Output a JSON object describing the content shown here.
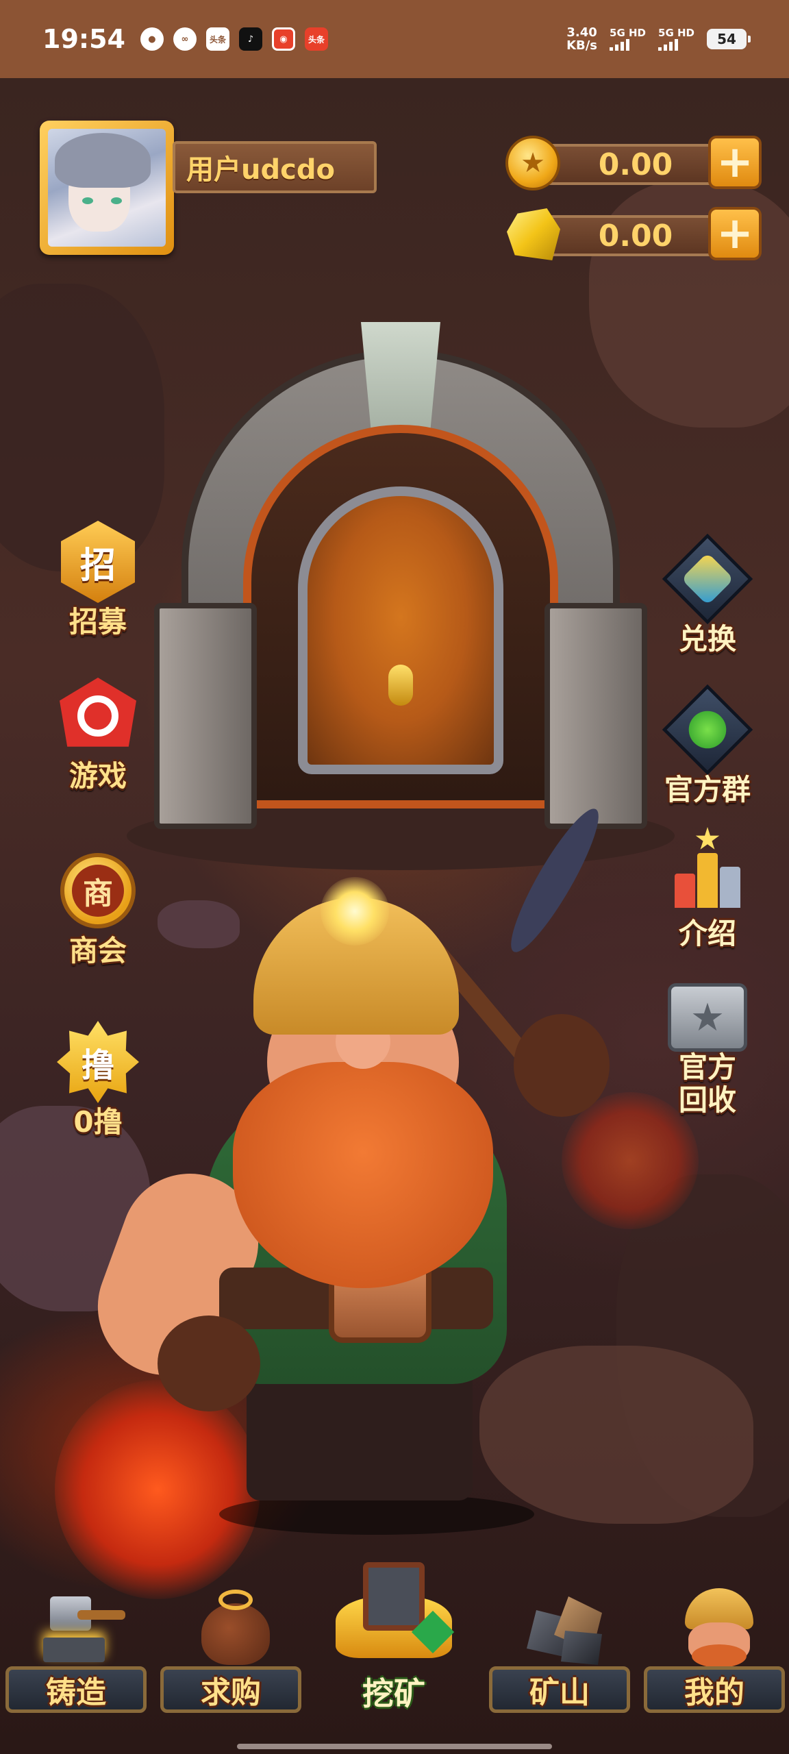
{
  "status_bar": {
    "time": "19:54",
    "notifications": [
      {
        "icon": "wechat-icon",
        "text": "",
        "color": "#8c5434"
      },
      {
        "icon": "link-app-icon",
        "text": "",
        "color": "#8c5434"
      },
      {
        "icon": "toutiao-icon",
        "text": "头条",
        "color": "#8c5434"
      },
      {
        "icon": "tiktok-icon",
        "text": "♪",
        "color": "#111111"
      },
      {
        "icon": "red-app-icon",
        "text": "",
        "color": "#e8402a"
      },
      {
        "icon": "toutiao-red-icon",
        "text": "头条",
        "color": "#e8402a"
      }
    ],
    "net_speed_value": "3.40",
    "net_speed_unit": "KB/s",
    "signal_1": "5G HD",
    "signal_2": "5G HD",
    "battery": "54"
  },
  "profile": {
    "username": "用户udcdo"
  },
  "currencies": {
    "coins": "0.00",
    "gold": "0.00",
    "plus": "+"
  },
  "left_menu": [
    {
      "name": "recruit",
      "badge": "招",
      "label": "招募"
    },
    {
      "name": "game",
      "badge": "",
      "label": "游戏"
    },
    {
      "name": "guild",
      "badge": "商",
      "label": "商会"
    },
    {
      "name": "zero-lu",
      "badge": "撸",
      "label": "0撸"
    }
  ],
  "right_menu": [
    {
      "name": "exchange",
      "label": "兑换"
    },
    {
      "name": "official-group",
      "label": "官方群"
    },
    {
      "name": "intro",
      "label": "介绍"
    },
    {
      "name": "official-recycle",
      "label": "官方\n回收"
    }
  ],
  "bottom_nav": [
    {
      "name": "forge",
      "label": "铸造"
    },
    {
      "name": "purchase",
      "label": "求购"
    },
    {
      "name": "mining",
      "label": "挖矿"
    },
    {
      "name": "mine",
      "label": "矿山"
    },
    {
      "name": "mine-profile",
      "label": "我的"
    }
  ],
  "colors": {
    "status_bar": "#8c5434",
    "label_gold": "#ffe08a",
    "plate_brown": "#6d4128",
    "currency_text": "#ffd36a"
  }
}
